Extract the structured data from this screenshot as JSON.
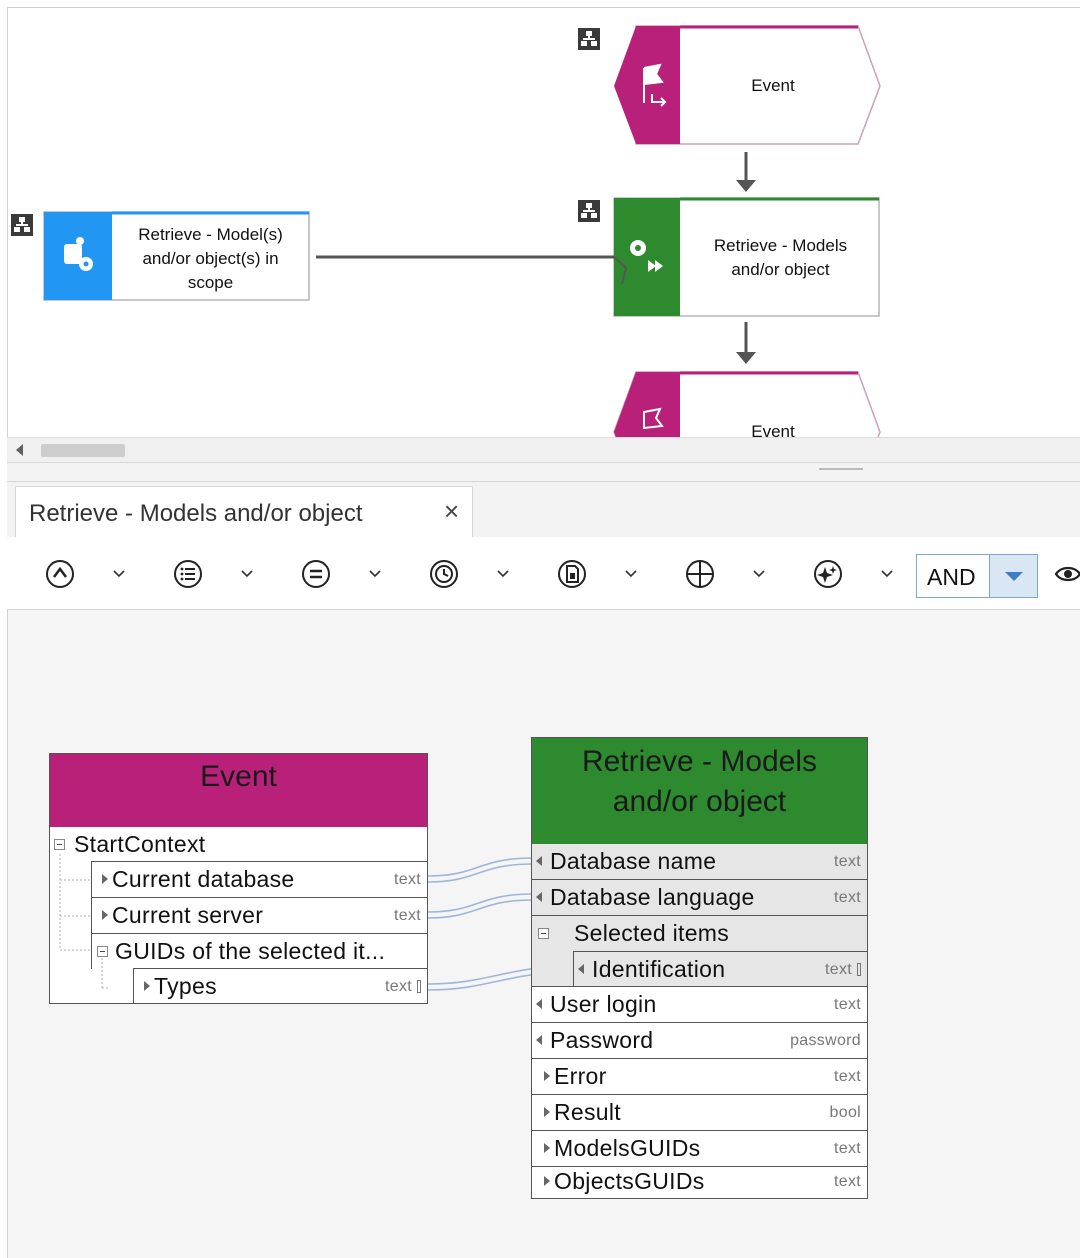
{
  "diagram": {
    "event_top_label": "Event",
    "function_main_label_line1": "Retrieve - Models",
    "function_main_label_line2": "and/or object",
    "event_bottom_label": "Event",
    "left_function_line1": "Retrieve - Model(s)",
    "left_function_line2": "and/or object(s) in",
    "left_function_line3": "scope",
    "colors": {
      "event": "#b8207a",
      "function": "#2e8a2e",
      "left_function": "#2196f3"
    }
  },
  "tab": {
    "title": "Retrieve - Models and/or object",
    "close_icon": "×"
  },
  "toolbar": {
    "buttons": [
      "collapse-up-icon",
      "list-icon",
      "equals-icon",
      "clock-icon",
      "document-icon",
      "crosshair-icon",
      "sparkle-icon"
    ],
    "operator_value": "AND"
  },
  "event_box": {
    "title": "Event",
    "rows": [
      {
        "label": "StartContext",
        "type": ""
      },
      {
        "label": "Current database",
        "type": "text"
      },
      {
        "label": "Current server",
        "type": "text"
      },
      {
        "label": "GUIDs of the selected it...",
        "type": ""
      },
      {
        "label": "Types",
        "type": "text"
      }
    ]
  },
  "function_box": {
    "title_line1": "Retrieve - Models",
    "title_line2": "and/or object",
    "rows": [
      {
        "label": "Database name",
        "type": "text"
      },
      {
        "label": "Database language",
        "type": "text"
      },
      {
        "label": "Selected items",
        "type": ""
      },
      {
        "label": "Identification",
        "type": "text"
      },
      {
        "label": "User login",
        "type": "text"
      },
      {
        "label": "Password",
        "type": "password"
      },
      {
        "label": "Error",
        "type": "text"
      },
      {
        "label": "Result",
        "type": "bool"
      },
      {
        "label": "ModelsGUIDs",
        "type": "text"
      },
      {
        "label": "ObjectsGUIDs",
        "type": "text"
      }
    ]
  }
}
